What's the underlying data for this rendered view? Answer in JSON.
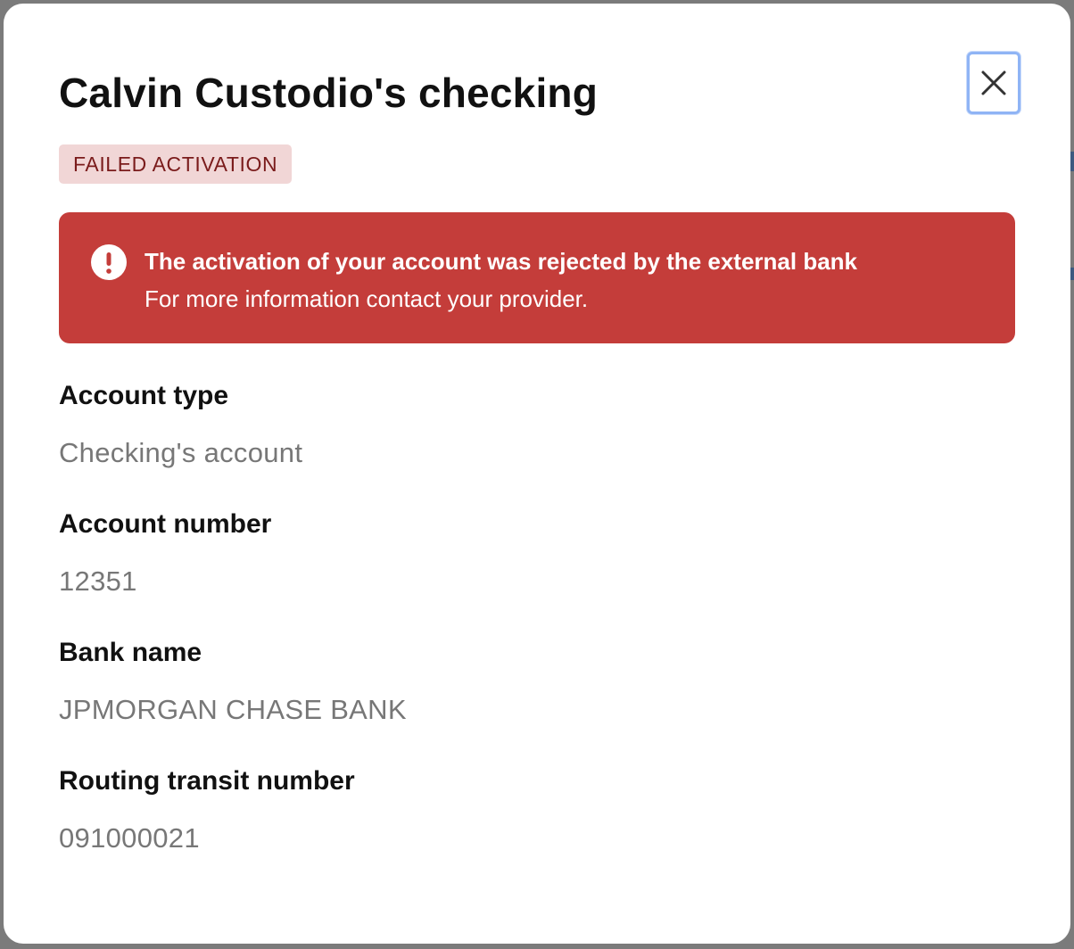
{
  "modal": {
    "title": "Calvin Custodio's checking",
    "close_icon": "close-icon",
    "status_badge": "FAILED ACTIVATION",
    "alert": {
      "icon": "exclamation-circle-icon",
      "title": "The activation of your account was rejected by the external bank",
      "message": "For more information contact your provider."
    },
    "fields": [
      {
        "label": "Account type",
        "value": "Checking's account"
      },
      {
        "label": "Account number",
        "value": "12351"
      },
      {
        "label": "Bank name",
        "value": "JPMORGAN CHASE BANK"
      },
      {
        "label": "Routing transit number",
        "value": "091000021"
      }
    ]
  },
  "colors": {
    "alert_background": "#c43d3a",
    "badge_background": "#f1d6d6",
    "badge_text": "#7a1b1b",
    "focus_ring": "#8fb4f5"
  }
}
